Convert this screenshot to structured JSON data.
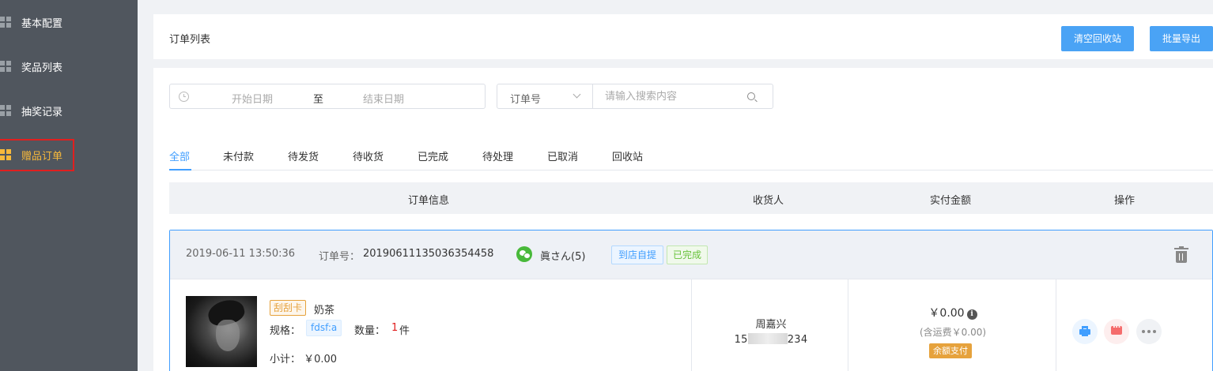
{
  "sidebar": {
    "items": [
      {
        "label": "基本配置",
        "icon": "grid-icon",
        "active": false
      },
      {
        "label": "奖品列表",
        "icon": "grid-icon",
        "active": false
      },
      {
        "label": "抽奖记录",
        "icon": "grid-icon",
        "active": false
      },
      {
        "label": "赠品订单",
        "icon": "grid-icon",
        "active": true
      }
    ]
  },
  "header": {
    "title": "订单列表",
    "clear_recycle_label": "清空回收站",
    "batch_export_label": "批量导出"
  },
  "filters": {
    "start_date_placeholder": "开始日期",
    "range_separator": "至",
    "end_date_placeholder": "结束日期",
    "search_type": "订单号",
    "search_placeholder": "请输入搜索内容"
  },
  "tabs": [
    "全部",
    "未付款",
    "待发货",
    "待收货",
    "已完成",
    "待处理",
    "已取消",
    "回收站"
  ],
  "active_tab": 0,
  "table": {
    "columns": [
      "订单信息",
      "收货人",
      "实付金额",
      "操作"
    ]
  },
  "order": {
    "time": "2019-06-11 13:50:36",
    "no_label": "订单号：",
    "no": "20190611135036354458",
    "buyer": "眞さん(5)",
    "delivery_tag": "到店自提",
    "status_tag": "已完成",
    "product": {
      "type_tag": "刮刮卡",
      "name": "奶茶",
      "spec_label": "规格：",
      "spec_value": "fdsf:a",
      "qty_label": "数量：",
      "qty_value": "1",
      "qty_unit": "件",
      "subtotal": "小计：  ￥0.00"
    },
    "receiver": {
      "name": "周嘉兴",
      "phone_prefix": "15",
      "phone_suffix": "234"
    },
    "payment": {
      "amount": "￥0.00",
      "shipping": "(含运费￥0.00)",
      "method": "余额支付"
    }
  },
  "colors": {
    "sidebar_bg": "#50565e",
    "active": "#f7b93b",
    "primary": "#409eff",
    "highlight_box": "#e11f1f"
  }
}
